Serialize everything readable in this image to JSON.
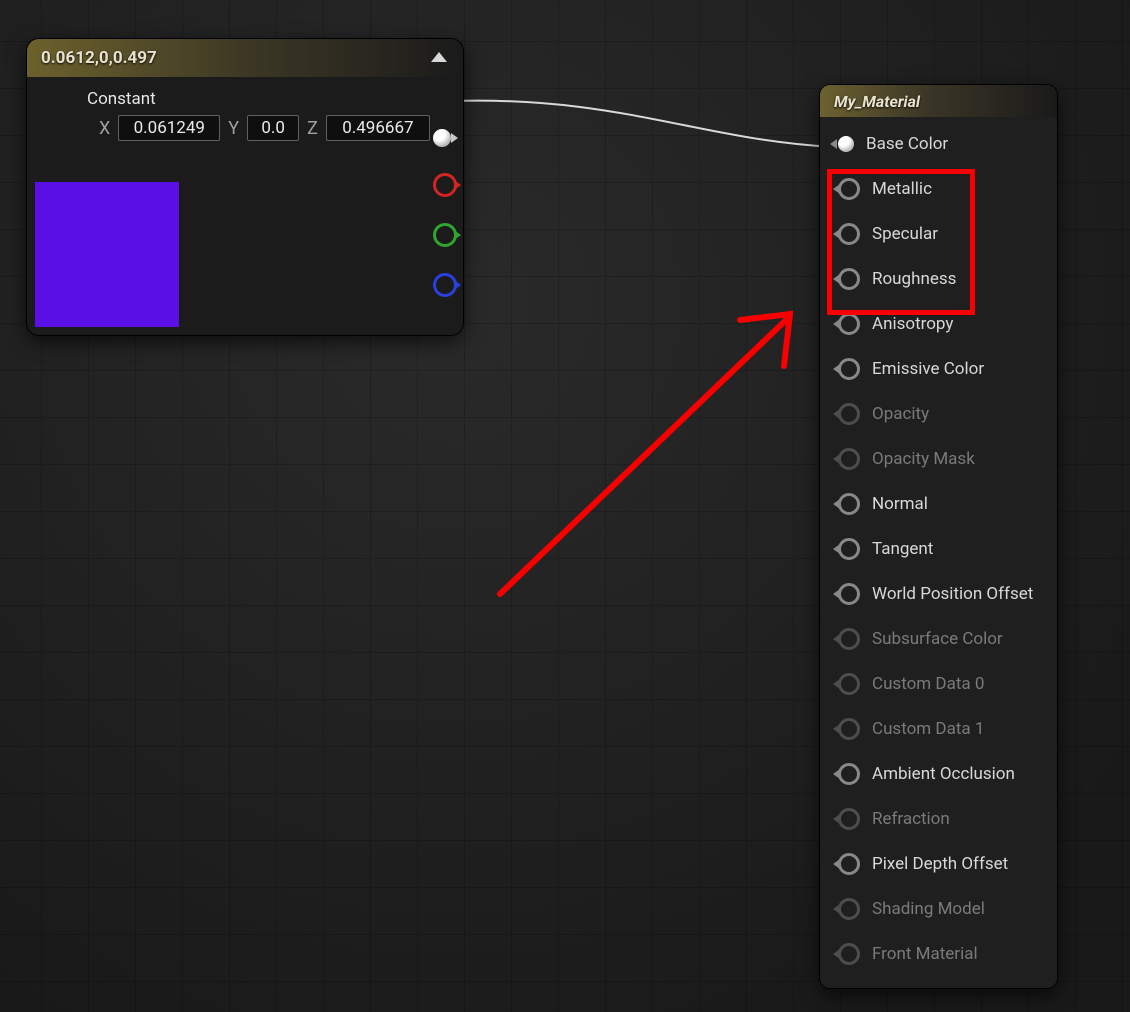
{
  "constant_node": {
    "title": "0.0612,0,0.497",
    "type_label": "Constant",
    "x_label": "X",
    "y_label": "Y",
    "z_label": "Z",
    "x_value": "0.061249",
    "y_value": "0.0",
    "z_value": "0.496667",
    "swatch_color": "#5a10e4",
    "out_pins": [
      "rgb",
      "r",
      "g",
      "b"
    ]
  },
  "material_node": {
    "title": "My_Material",
    "inputs": [
      {
        "label": "Base Color",
        "enabled": true,
        "connected": true
      },
      {
        "label": "Metallic",
        "enabled": true,
        "connected": false
      },
      {
        "label": "Specular",
        "enabled": true,
        "connected": false
      },
      {
        "label": "Roughness",
        "enabled": true,
        "connected": false
      },
      {
        "label": "Anisotropy",
        "enabled": true,
        "connected": false
      },
      {
        "label": "Emissive Color",
        "enabled": true,
        "connected": false
      },
      {
        "label": "Opacity",
        "enabled": false,
        "connected": false
      },
      {
        "label": "Opacity Mask",
        "enabled": false,
        "connected": false
      },
      {
        "label": "Normal",
        "enabled": true,
        "connected": false
      },
      {
        "label": "Tangent",
        "enabled": true,
        "connected": false
      },
      {
        "label": "World Position Offset",
        "enabled": true,
        "connected": false
      },
      {
        "label": "Subsurface Color",
        "enabled": false,
        "connected": false
      },
      {
        "label": "Custom Data 0",
        "enabled": false,
        "connected": false
      },
      {
        "label": "Custom Data 1",
        "enabled": false,
        "connected": false
      },
      {
        "label": "Ambient Occlusion",
        "enabled": true,
        "connected": false
      },
      {
        "label": "Refraction",
        "enabled": false,
        "connected": false
      },
      {
        "label": "Pixel Depth Offset",
        "enabled": true,
        "connected": false
      },
      {
        "label": "Shading Model",
        "enabled": false,
        "connected": false
      },
      {
        "label": "Front Material",
        "enabled": false,
        "connected": false
      }
    ]
  },
  "annotation": {
    "highlighted_inputs": [
      "Metallic",
      "Specular",
      "Roughness"
    ],
    "arrow_color": "#f80000"
  }
}
